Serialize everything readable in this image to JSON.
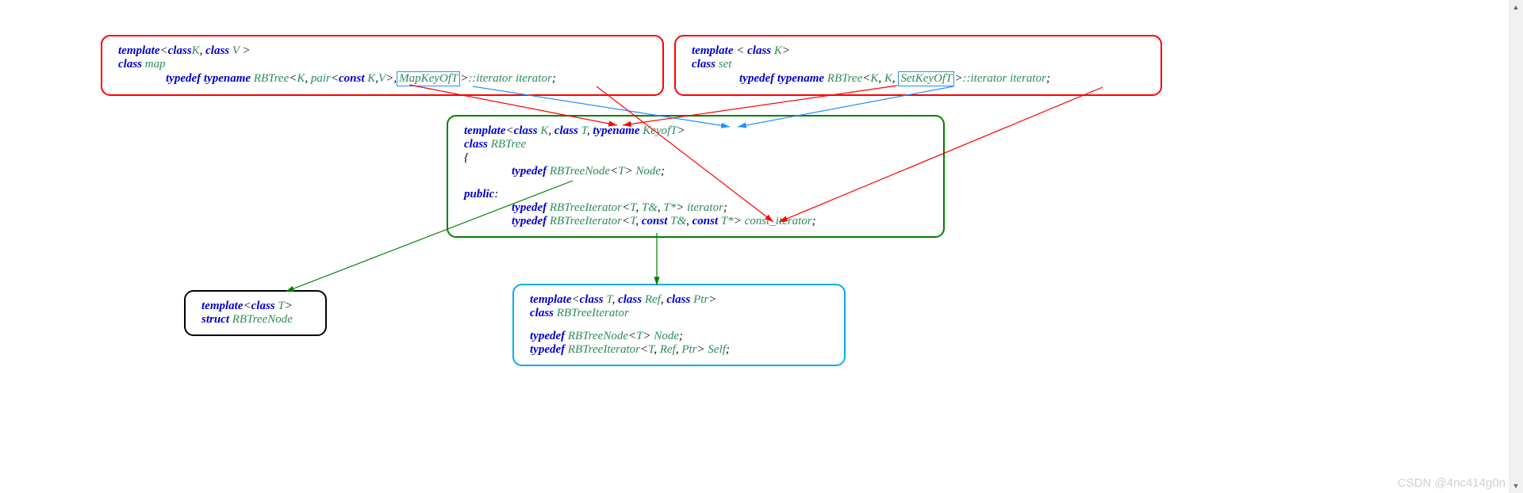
{
  "map_box": {
    "l1_template": "template",
    "l1_open": "<",
    "l1_class1": "class",
    "l1_K": "K",
    "l1_comma": ", ",
    "l1_class2": "class",
    "l1_V": " V ",
    "l1_close": ">",
    "l2_class": "class",
    "l2_map": " map",
    "l3_typedef": "typedef ",
    "l3_typename": "typename ",
    "l3_rbtree": "RBTree",
    "l3_open": "<",
    "l3_K": "K",
    "l3_c1": ", ",
    "l3_pair": "pair",
    "l3_pair_open": "<",
    "l3_const": "const ",
    "l3_K2": "K",
    "l3_c2": ",",
    "l3_V": "V",
    "l3_pair_close": ">",
    "l3_c3": ",",
    "l3_keyoft": "MapKeyOfT",
    "l3_close": ">",
    "l3_iter1": "::iterator ",
    "l3_iter2": "iterator",
    "l3_semi": ";"
  },
  "set_box": {
    "l1_template": "template ",
    "l1_open": "< ",
    "l1_class": "class",
    "l1_K": " K",
    "l1_close": ">",
    "l2_class": "class",
    "l2_set": " set",
    "l3_typedef": "typedef ",
    "l3_typename": "typename ",
    "l3_rbtree": "RBTree",
    "l3_open": "<",
    "l3_K": "K",
    "l3_c1": ", ",
    "l3_K2": "K",
    "l3_c2": ", ",
    "l3_keyoft": "SetKeyOfT",
    "l3_close": ">",
    "l3_iter1": "::iterator ",
    "l3_iter2": "iterator",
    "l3_semi": ";"
  },
  "rbtree_box": {
    "l1_template": "template",
    "l1_open": "<",
    "l1_class1": "class",
    "l1_K": " K",
    "l1_c1": ", ",
    "l1_class2": "class",
    "l1_T": " T",
    "l1_c2": ", ",
    "l1_typename": "typename",
    "l1_keyoft": " KeyofT",
    "l1_close": ">",
    "l2_class": "class",
    "l2_rbtree": " RBTree",
    "l3_brace": "{",
    "l4_typedef": "typedef ",
    "l4_rbtreenode": "RBTreeNode",
    "l4_open": "<",
    "l4_T": "T",
    "l4_close": "> ",
    "l4_node": "Node",
    "l4_semi": ";",
    "l5_public": "public",
    "l5_colon": ":",
    "l6_typedef": "typedef ",
    "l6_iter": "RBTreeIterator",
    "l6_open": "<",
    "l6_T": "T",
    "l6_c1": ", ",
    "l6_Tref": "T&",
    "l6_c2": ", ",
    "l6_Tptr": "T*",
    "l6_close": "> ",
    "l6_iterator": "iterator",
    "l6_semi": ";",
    "l7_typedef": "typedef ",
    "l7_iter": "RBTreeIterator",
    "l7_open": "<",
    "l7_T": "T",
    "l7_c1": ", ",
    "l7_const1": "const",
    "l7_Tref": " T&",
    "l7_c2": ", ",
    "l7_const2": "const",
    "l7_Tptr": " T*",
    "l7_close": "> ",
    "l7_iterator": "const_iterator",
    "l7_semi": ";"
  },
  "node_box": {
    "l1_template": "template",
    "l1_open": "<",
    "l1_class": "class",
    "l1_T": " T",
    "l1_close": ">",
    "l2_struct": "struct",
    "l2_name": " RBTreeNode"
  },
  "iter_box": {
    "l1_template": "template",
    "l1_open": "<",
    "l1_class1": "class",
    "l1_T": " T",
    "l1_c1": ", ",
    "l1_class2": "class",
    "l1_Ref": " Ref",
    "l1_c2": ", ",
    "l1_class3": "class",
    "l1_Ptr": " Ptr",
    "l1_close": ">",
    "l2_class": "class",
    "l2_name": " RBTreeIterator",
    "l3_typedef": "typedef ",
    "l3_node": "RBTreeNode",
    "l3_open": "<",
    "l3_T": "T",
    "l3_close": "> ",
    "l3_Node": "Node",
    "l3_semi": ";",
    "l4_typedef": "typedef ",
    "l4_iter": "RBTreeIterator",
    "l4_open": "<",
    "l4_T": "T",
    "l4_c1": ", ",
    "l4_Ref": "Ref",
    "l4_c2": ", ",
    "l4_Ptr": "Ptr",
    "l4_close": "> ",
    "l4_Self": "Self",
    "l4_semi": ";"
  },
  "watermark": "CSDN @4nc414g0n"
}
